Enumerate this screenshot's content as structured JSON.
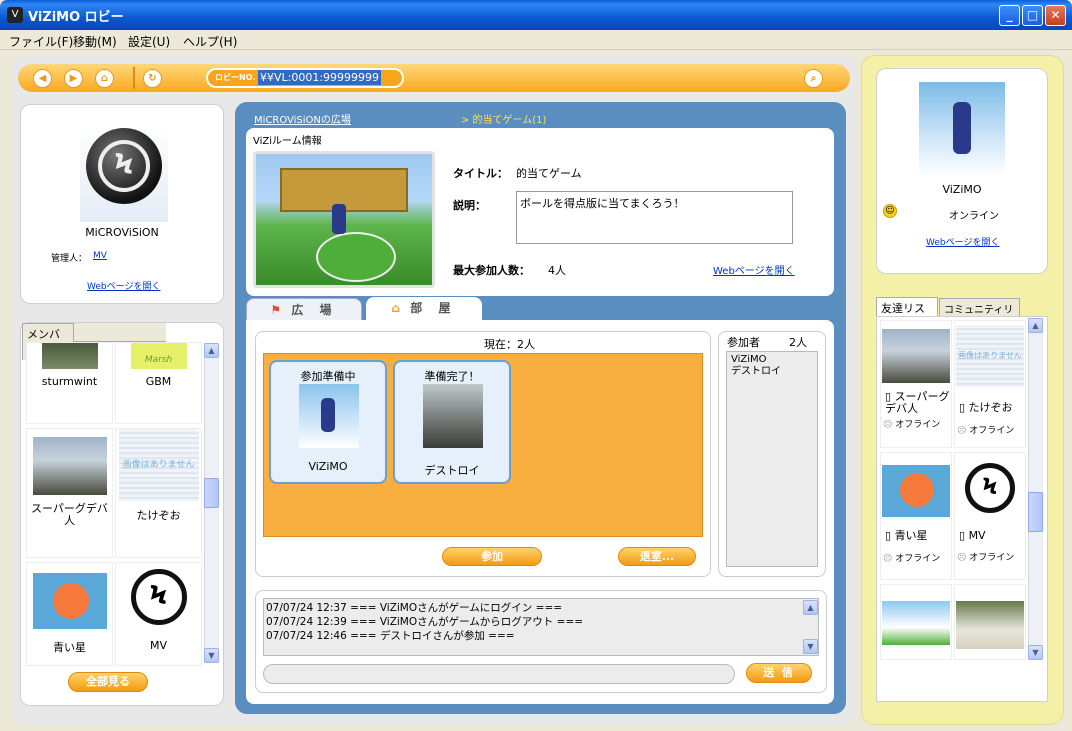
{
  "window": {
    "title": "ViZiMO ロビー",
    "icon": "vizimo-app-icon"
  },
  "menu": [
    "ファイル(F)",
    "移動(M)",
    "設定(U)",
    "ヘルプ(H)"
  ],
  "nav": {
    "lobby_label": "ロビーNO.",
    "lobby_value": "¥¥VL:0001:99999999",
    "icons": [
      "back-icon",
      "forward-icon",
      "home-icon",
      "refresh-icon",
      "search-icon"
    ]
  },
  "owner": {
    "name": "MiCROViSiON",
    "admin_label": "管理人：",
    "admin_name": "MV",
    "web_link": "Webページを開く"
  },
  "members": {
    "tab": "メンバー",
    "items": [
      {
        "name": "sturmwint"
      },
      {
        "name": "GBM",
        "thumb_text": "Marsh"
      },
      {
        "name": "スーパーグデバ人"
      },
      {
        "name": "たけぞお",
        "thumb_text": "画像はありません"
      },
      {
        "name": "青い星"
      },
      {
        "name": "MV"
      }
    ],
    "show_all": "全部見る"
  },
  "room": {
    "breadcrumb_root": "MiCROViSiONの広場",
    "breadcrumb_current": "> 的当てゲーム(1)",
    "section_title": "ViZiルーム情報",
    "title_label": "タイトル：",
    "title_value": "的当てゲーム",
    "desc_label": "説明：",
    "desc_value": "ボールを得点版に当てまくろう！",
    "max_label": "最大参加人数：",
    "max_value": "4人",
    "web_link": "Webページを開く"
  },
  "tabs": {
    "plaza": "広 場",
    "room": "部 屋"
  },
  "lobby": {
    "current": "現在：2人",
    "players": [
      {
        "status": "参加準備中",
        "name": "ViZiMO"
      },
      {
        "status": "準備完了！",
        "name": "デストロイ"
      }
    ],
    "join": "参加",
    "leave": "退室..."
  },
  "participants": {
    "label": "参加者",
    "count": "2人",
    "names": [
      "ViZiMO",
      "デストロイ"
    ]
  },
  "chat": {
    "lines": [
      "07/07/24 12:37 === ViZiMOさんがゲームにログイン ===",
      "07/07/24 12:39 === ViZiMOさんがゲームからログアウト ===",
      "07/07/24 12:46 === デストロイさんが参加 ==="
    ],
    "send": "送 信"
  },
  "profile": {
    "name": "ViZiMO",
    "status": "オンライン",
    "web_link": "Webページを開く"
  },
  "friends": {
    "tabs": [
      "友達リスト",
      "コミュニティリスト"
    ],
    "items": [
      {
        "name": "スーパーグデバ人",
        "status": "オフライン"
      },
      {
        "name": "たけぞお",
        "status": "オフライン",
        "thumb_text": "画像はありません"
      },
      {
        "name": "青い星",
        "status": "オフライン"
      },
      {
        "name": "MV",
        "status": "オフライン"
      }
    ]
  }
}
